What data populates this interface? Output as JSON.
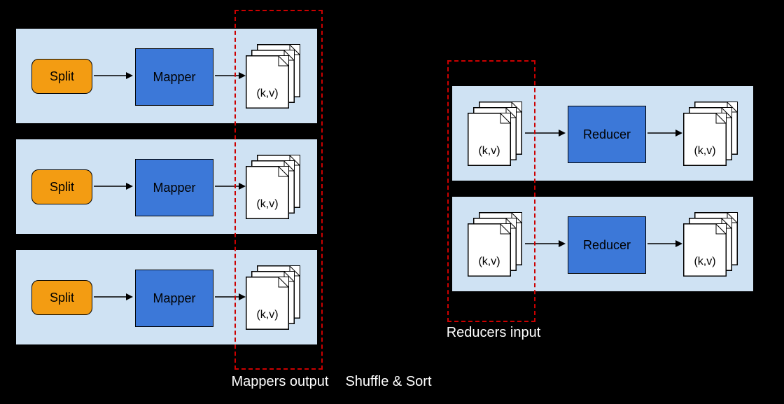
{
  "labels": {
    "split": "Split",
    "mapper": "Mapper",
    "reducer": "Reducer",
    "kv": "(k,v)"
  },
  "footers": {
    "mappers_out": "Mappers output",
    "shuffle_sort": "Shuffle & Sort",
    "reducers_in": "Reducers input"
  }
}
